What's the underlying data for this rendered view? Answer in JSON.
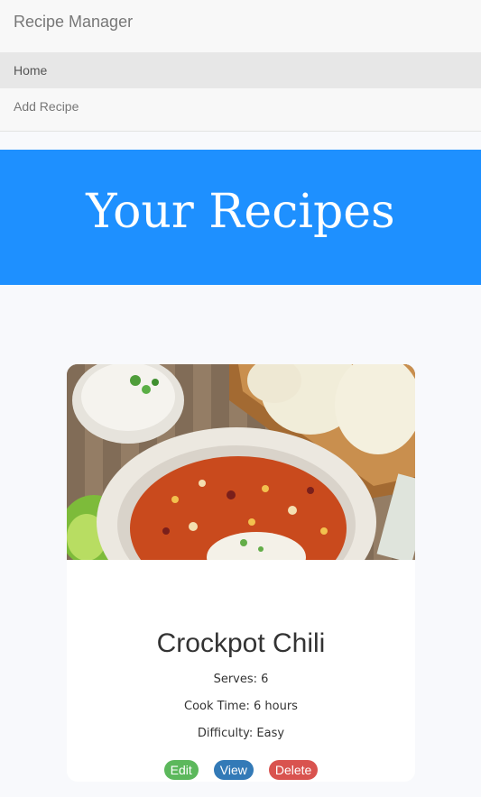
{
  "navbar": {
    "brand": "Recipe Manager",
    "items": [
      {
        "label": "Home",
        "active": true
      },
      {
        "label": "Add Recipe",
        "active": false
      }
    ]
  },
  "hero": {
    "title": "Your Recipes",
    "background": "#1e90ff"
  },
  "recipes": [
    {
      "image": "chili-bowl-photo",
      "title": "Crockpot Chili",
      "serves": "Serves: 6",
      "cook_time": "Cook Time: 6 hours",
      "difficulty": "Difficulty: Easy",
      "actions": {
        "edit": "Edit",
        "view": "View",
        "delete": "Delete"
      }
    }
  ],
  "colors": {
    "edit": "#5cb85c",
    "view": "#337ab7",
    "delete": "#d9534f"
  }
}
